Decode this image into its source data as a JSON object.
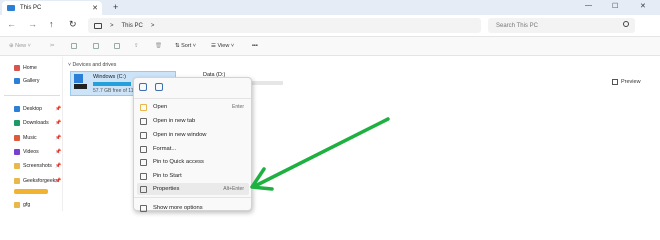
{
  "window": {
    "tab_title": "This PC",
    "new_tab": "+",
    "controls": {
      "minimize": "—",
      "maximize": "☐",
      "close": "✕"
    }
  },
  "addressbar": {
    "path": "This PC",
    "separator": ">",
    "search_placeholder": "Search This PC"
  },
  "toolbar": {
    "new_label": "New",
    "sort_label": "Sort",
    "view_label": "View",
    "more_label": "•••",
    "preview_label": "Preview"
  },
  "sidebar": {
    "top_items": [
      {
        "label": "Home",
        "icon": "home-icon",
        "color": "#d9534f"
      },
      {
        "label": "Gallery",
        "icon": "gallery-icon",
        "color": "#2b7fd6"
      }
    ],
    "pinned_items": [
      {
        "label": "Desktop",
        "icon": "desktop-icon",
        "color": "#2b7fd6"
      },
      {
        "label": "Downloads",
        "icon": "downloads-icon",
        "color": "#1e9b64"
      },
      {
        "label": "Music",
        "icon": "music-icon",
        "color": "#e05a3a"
      },
      {
        "label": "Videos",
        "icon": "videos-icon",
        "color": "#7b3fd0"
      },
      {
        "label": "Screenshots",
        "icon": "folder-icon",
        "color": "#e8b84a"
      },
      {
        "label": "Geeksforgeeks",
        "icon": "folder-icon",
        "color": "#e8b84a"
      },
      {
        "label": "gfg",
        "icon": "folder-icon",
        "color": "#e8b84a"
      }
    ],
    "pin_glyph": "📌"
  },
  "content": {
    "section_label": "Devices and drives",
    "drives": [
      {
        "name": "Windows (C:)",
        "free_text": "57.7 GB free of 11",
        "usage_fraction": 0.48
      },
      {
        "name": "Data (D:)"
      }
    ]
  },
  "context_menu": {
    "items": [
      {
        "label": "Open",
        "shortcut": "Enter",
        "icon": "open-icon"
      },
      {
        "label": "Open in new tab",
        "shortcut": "",
        "icon": "new-tab-icon"
      },
      {
        "label": "Open in new window",
        "shortcut": "",
        "icon": "new-window-icon"
      },
      {
        "label": "Format...",
        "shortcut": "",
        "icon": "format-icon"
      },
      {
        "label": "Pin to Quick access",
        "shortcut": "",
        "icon": "pin-icon"
      },
      {
        "label": "Pin to Start",
        "shortcut": "",
        "icon": "pin-start-icon"
      },
      {
        "label": "Properties",
        "shortcut": "Alt+Enter",
        "icon": "properties-icon"
      },
      {
        "label": "Show more options",
        "shortcut": "",
        "icon": "more-options-icon"
      }
    ],
    "highlighted_index": 6
  },
  "colors": {
    "accent": "#2b7fd6",
    "arrow": "#1eb040",
    "selection": "#cde3f7"
  }
}
